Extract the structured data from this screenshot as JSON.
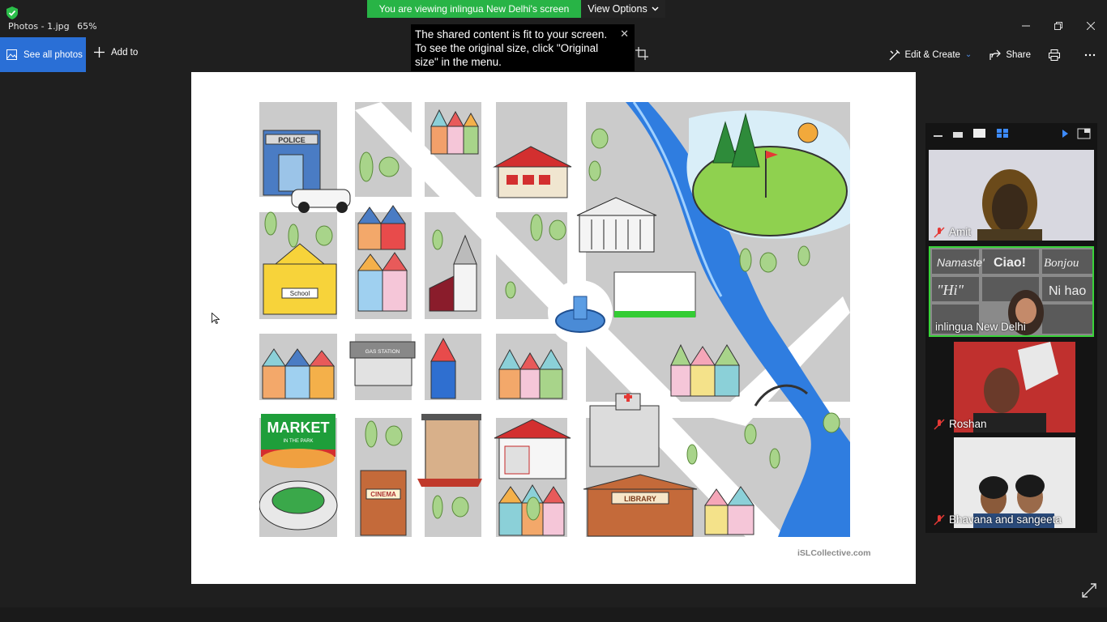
{
  "window": {
    "app_title": "Photos - 1.jpg",
    "zoom": "65%",
    "minimize_icon": "minimize-icon",
    "maximize_icon": "maximize-icon",
    "close_icon": "close-icon"
  },
  "share_banner": {
    "text": "You are viewing inlingua New Delhi's screen",
    "view_options": "View Options",
    "color": "#28b446"
  },
  "tooltip": {
    "text": "The shared content is fit to your screen. To see the original size, click \"Original size\" in the menu."
  },
  "toolbar": {
    "see_all_photos": "See all photos",
    "add_to": "Add to",
    "edit_create": "Edit & Create",
    "share": "Share",
    "accent": "#2a6fd6"
  },
  "image": {
    "watermark": "iSLCollective.com",
    "labels": {
      "police": "POLICE",
      "school": "School",
      "gas_station": "GAS STATION",
      "market": "MARKET",
      "market_sub": "IN THE PARK",
      "cinema": "CINEMA",
      "library": "LIBRARY"
    }
  },
  "gallery": {
    "participants": [
      {
        "name": "Amit",
        "muted": true
      },
      {
        "name": "inlingua New Delhi",
        "muted": false,
        "active_speaker": true
      },
      {
        "name": "Roshan",
        "muted": true
      },
      {
        "name": "Bhavana and sangeeta",
        "muted": true
      }
    ],
    "active_color": "#3ad33a"
  }
}
